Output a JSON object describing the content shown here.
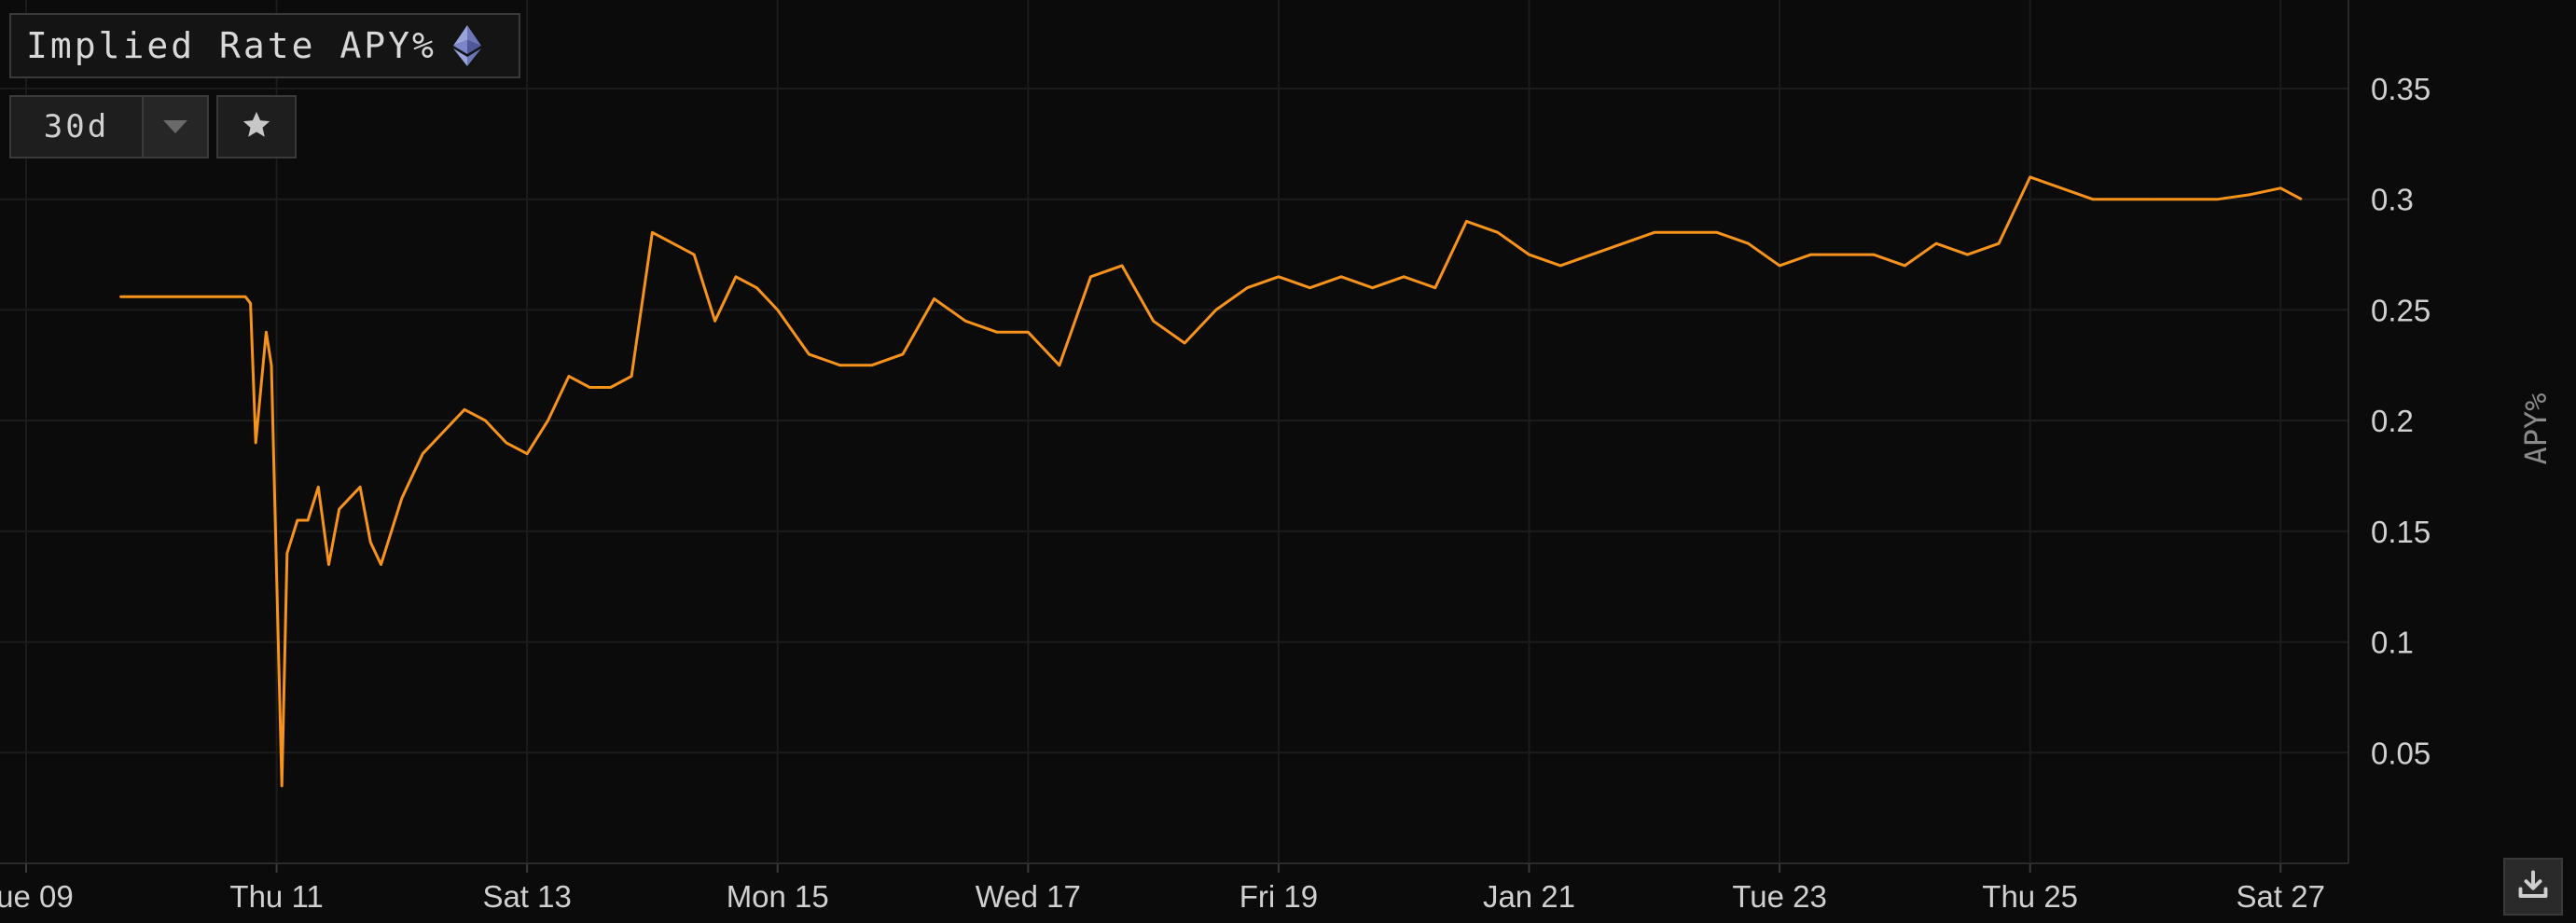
{
  "header": {
    "title": "Implied Rate APY%",
    "title_icon": "ethereum-icon"
  },
  "controls": {
    "range_value": "30d",
    "range_caret_icon": "caret-down-icon",
    "favorite_icon": "star-icon"
  },
  "download_icon": "download-icon",
  "colors": {
    "background": "#0b0b0b",
    "series": "#f7931a",
    "grid": "#1c1c1c",
    "tick_text": "#d0d0d0",
    "axis_title": "#8a8a8a"
  },
  "chart_data": {
    "type": "line",
    "title": "Implied Rate APY%",
    "xlabel": "",
    "ylabel": "APY%",
    "y_axis_position": "right",
    "grid": true,
    "legend": "none",
    "ylim": [
      0,
      0.39
    ],
    "yticks": [
      0.05,
      0.1,
      0.15,
      0.2,
      0.25,
      0.3,
      0.35
    ],
    "ytick_labels": [
      "0.05",
      "0.1",
      "0.15",
      "0.2",
      "0.25",
      "0.3",
      "0.35"
    ],
    "xlim": [
      "2024-01-08T19:00",
      "2024-01-27T13:00"
    ],
    "xticks": [
      "2024-01-09",
      "2024-01-11",
      "2024-01-13",
      "2024-01-15",
      "2024-01-17",
      "2024-01-19",
      "2024-01-21",
      "2024-01-23",
      "2024-01-25",
      "2024-01-27"
    ],
    "xtick_labels": [
      "Tue 09",
      "Thu 11",
      "Sat 13",
      "Mon 15",
      "Wed 17",
      "Fri 19",
      "Jan 21",
      "Tue 23",
      "Thu 25",
      "Sat 27"
    ],
    "series": [
      {
        "x": [
          "2024-01-09T18:00",
          "2024-01-10T02:00",
          "2024-01-10T12:00",
          "2024-01-10T18:00",
          "2024-01-10T19:00",
          "2024-01-10T20:00",
          "2024-01-10T21:00",
          "2024-01-10T22:00",
          "2024-01-10T23:00",
          "2024-01-11T00:00",
          "2024-01-11T01:00",
          "2024-01-11T02:00",
          "2024-01-11T04:00",
          "2024-01-11T06:00",
          "2024-01-11T08:00",
          "2024-01-11T10:00",
          "2024-01-11T12:00",
          "2024-01-11T14:00",
          "2024-01-11T16:00",
          "2024-01-11T18:00",
          "2024-01-11T20:00",
          "2024-01-11T22:00",
          "2024-01-12T00:00",
          "2024-01-12T04:00",
          "2024-01-12T08:00",
          "2024-01-12T12:00",
          "2024-01-12T16:00",
          "2024-01-12T20:00",
          "2024-01-13T00:00",
          "2024-01-13T04:00",
          "2024-01-13T08:00",
          "2024-01-13T12:00",
          "2024-01-13T16:00",
          "2024-01-13T20:00",
          "2024-01-14T00:00",
          "2024-01-14T04:00",
          "2024-01-14T08:00",
          "2024-01-14T12:00",
          "2024-01-14T16:00",
          "2024-01-14T20:00",
          "2024-01-15T00:00",
          "2024-01-15T06:00",
          "2024-01-15T12:00",
          "2024-01-15T18:00",
          "2024-01-16T00:00",
          "2024-01-16T06:00",
          "2024-01-16T12:00",
          "2024-01-16T18:00",
          "2024-01-17T00:00",
          "2024-01-17T06:00",
          "2024-01-17T12:00",
          "2024-01-17T18:00",
          "2024-01-18T00:00",
          "2024-01-18T06:00",
          "2024-01-18T12:00",
          "2024-01-18T18:00",
          "2024-01-19T00:00",
          "2024-01-19T06:00",
          "2024-01-19T12:00",
          "2024-01-19T18:00",
          "2024-01-20T00:00",
          "2024-01-20T06:00",
          "2024-01-20T12:00",
          "2024-01-20T18:00",
          "2024-01-21T00:00",
          "2024-01-21T06:00",
          "2024-01-21T12:00",
          "2024-01-21T18:00",
          "2024-01-22T00:00",
          "2024-01-22T06:00",
          "2024-01-22T12:00",
          "2024-01-22T18:00",
          "2024-01-23T00:00",
          "2024-01-23T06:00",
          "2024-01-23T12:00",
          "2024-01-23T18:00",
          "2024-01-24T00:00",
          "2024-01-24T06:00",
          "2024-01-24T12:00",
          "2024-01-24T18:00",
          "2024-01-25T00:00",
          "2024-01-25T06:00",
          "2024-01-25T12:00",
          "2024-01-25T18:00",
          "2024-01-26T00:00",
          "2024-01-26T06:00",
          "2024-01-26T12:00",
          "2024-01-26T18:00",
          "2024-01-27T00:00",
          "2024-01-27T04:00"
        ],
        "values": [
          0.256,
          0.256,
          0.256,
          0.256,
          0.253,
          0.19,
          0.215,
          0.24,
          0.225,
          0.13,
          0.035,
          0.14,
          0.155,
          0.155,
          0.17,
          0.135,
          0.16,
          0.165,
          0.17,
          0.145,
          0.135,
          0.15,
          0.165,
          0.185,
          0.195,
          0.205,
          0.2,
          0.19,
          0.185,
          0.2,
          0.22,
          0.215,
          0.215,
          0.22,
          0.285,
          0.28,
          0.275,
          0.245,
          0.265,
          0.26,
          0.25,
          0.23,
          0.225,
          0.225,
          0.23,
          0.255,
          0.245,
          0.24,
          0.24,
          0.225,
          0.265,
          0.27,
          0.245,
          0.235,
          0.25,
          0.26,
          0.265,
          0.26,
          0.265,
          0.26,
          0.265,
          0.26,
          0.29,
          0.285,
          0.275,
          0.27,
          0.275,
          0.28,
          0.285,
          0.285,
          0.285,
          0.28,
          0.27,
          0.275,
          0.275,
          0.275,
          0.27,
          0.28,
          0.275,
          0.28,
          0.31,
          0.305,
          0.3,
          0.3,
          0.3,
          0.3,
          0.3,
          0.302,
          0.305,
          0.3
        ]
      }
    ]
  }
}
